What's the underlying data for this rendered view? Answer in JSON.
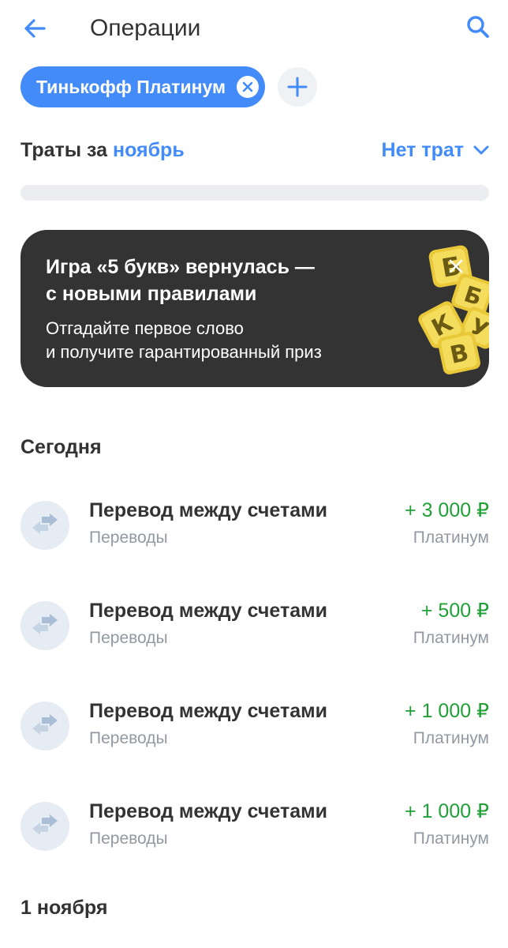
{
  "header": {
    "back_icon": "arrow-left-icon",
    "title": "Операции",
    "search_icon": "search-icon"
  },
  "filters": {
    "active_chip": {
      "label": "Тинькофф Платинум",
      "close_icon": "close-circle-icon"
    },
    "add_icon": "plus-icon"
  },
  "spending": {
    "title_prefix": "Траты за ",
    "month": "ноябрь",
    "status": "Нет трат",
    "dropdown_icon": "chevron-down-icon"
  },
  "promo": {
    "title_line1": "Игра «5 букв» вернулась —",
    "title_line2": "с новыми правилами",
    "text_line1": "Отгадайте первое слово",
    "text_line2": "и получите гарантированный приз",
    "letters": [
      "Б",
      "Б",
      "У",
      "К",
      "В"
    ],
    "close_icon": "close-icon"
  },
  "sections": [
    {
      "title": "Сегодня",
      "operations": [
        {
          "title": "Перевод между счетами",
          "category": "Переводы",
          "amount": "+ 3 000 ₽",
          "account": "Платинум",
          "icon": "transfer-arrows-icon"
        },
        {
          "title": "Перевод между счетами",
          "category": "Переводы",
          "amount": "+ 500 ₽",
          "account": "Платинум",
          "icon": "transfer-arrows-icon"
        },
        {
          "title": "Перевод между счетами",
          "category": "Переводы",
          "amount": "+ 1 000 ₽",
          "account": "Платинум",
          "icon": "transfer-arrows-icon"
        },
        {
          "title": "Перевод между счетами",
          "category": "Переводы",
          "amount": "+ 1 000 ₽",
          "account": "Платинум",
          "icon": "transfer-arrows-icon"
        }
      ]
    },
    {
      "title": "1 ноября",
      "operations": []
    }
  ],
  "colors": {
    "accent": "#428bf9",
    "income": "#21a038",
    "muted": "#9299a2",
    "text": "#333333",
    "banner": "#333333"
  }
}
